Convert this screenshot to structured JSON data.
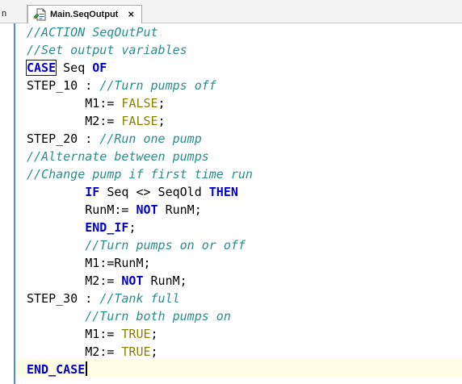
{
  "tabs": {
    "previous_label": "n",
    "active_label": "Main.SeqOutput",
    "close_glyph": "×"
  },
  "code_lines": [
    [
      {
        "t": "//ACTION SeqOutPut",
        "c": "cm"
      }
    ],
    [
      {
        "t": "//Set output variables",
        "c": "cm"
      }
    ],
    [
      {
        "t": "CASE",
        "c": "kw",
        "box": true
      },
      {
        "t": " Seq ",
        "c": "id"
      },
      {
        "t": "OF",
        "c": "kw"
      }
    ],
    [
      {
        "t": "STEP_10 : ",
        "c": "id"
      },
      {
        "t": "//Turn pumps off",
        "c": "cm"
      }
    ],
    [
      {
        "t": "        M1:= ",
        "c": "id"
      },
      {
        "t": "FALSE",
        "c": "lit"
      },
      {
        "t": ";",
        "c": "id"
      }
    ],
    [
      {
        "t": "        M2:= ",
        "c": "id"
      },
      {
        "t": "FALSE",
        "c": "lit"
      },
      {
        "t": ";",
        "c": "id"
      }
    ],
    [
      {
        "t": "STEP_20 : ",
        "c": "id"
      },
      {
        "t": "//Run one pump",
        "c": "cm"
      }
    ],
    [
      {
        "t": "//Alternate between pumps",
        "c": "cm"
      }
    ],
    [
      {
        "t": "//Change pump if first time run",
        "c": "cm"
      }
    ],
    [
      {
        "t": "        ",
        "c": "id"
      },
      {
        "t": "IF",
        "c": "kw"
      },
      {
        "t": " Seq <> SeqOld ",
        "c": "id"
      },
      {
        "t": "THEN",
        "c": "kw"
      }
    ],
    [
      {
        "t": "        RunM:= ",
        "c": "id"
      },
      {
        "t": "NOT",
        "c": "kw"
      },
      {
        "t": " RunM;",
        "c": "id"
      }
    ],
    [
      {
        "t": "        ",
        "c": "id"
      },
      {
        "t": "END_IF",
        "c": "kw"
      },
      {
        "t": ";",
        "c": "id"
      }
    ],
    [
      {
        "t": "        ",
        "c": "id"
      },
      {
        "t": "//Turn pumps on or off",
        "c": "cm"
      }
    ],
    [
      {
        "t": "        M1:=RunM;",
        "c": "id"
      }
    ],
    [
      {
        "t": "        M2:= ",
        "c": "id"
      },
      {
        "t": "NOT",
        "c": "kw"
      },
      {
        "t": " RunM;",
        "c": "id"
      }
    ],
    [
      {
        "t": "STEP_30 : ",
        "c": "id"
      },
      {
        "t": "//Tank full",
        "c": "cm"
      }
    ],
    [
      {
        "t": "        ",
        "c": "id"
      },
      {
        "t": "//Turn both pumps on",
        "c": "cm"
      }
    ],
    [
      {
        "t": "        M1:= ",
        "c": "id"
      },
      {
        "t": "TRUE",
        "c": "lit"
      },
      {
        "t": ";",
        "c": "id"
      }
    ],
    [
      {
        "t": "        M2:= ",
        "c": "id"
      },
      {
        "t": "TRUE",
        "c": "lit"
      },
      {
        "t": ";",
        "c": "id"
      }
    ],
    [
      {
        "t": "END_CASE",
        "c": "kw"
      }
    ]
  ],
  "cursor_line_index": 19,
  "colors": {
    "comment": "#2a8c8c",
    "keyword": "#0000cc",
    "literal": "#8b8000",
    "gutter": "#4a8fd8",
    "current_line": "#fffde2"
  },
  "icons": {
    "tab_icon": "st-file-icon"
  }
}
